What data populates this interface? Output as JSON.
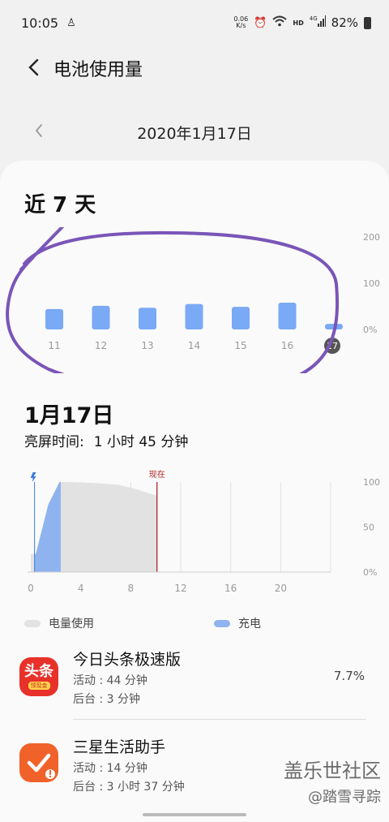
{
  "status_bar": {
    "time": "10:05",
    "net_speed_value": "0.06",
    "net_speed_unit": "K/s",
    "net_label": "HD",
    "net_type": "4G",
    "battery": "82%",
    "icons": [
      "notification-icon",
      "alarm-icon",
      "wifi-icon",
      "signal-icon",
      "battery-icon"
    ]
  },
  "header": {
    "title": "电池使用量",
    "back_icon": "back-arrow-icon"
  },
  "date_nav": {
    "date": "2020年1月17日",
    "prev_icon": "chevron-left-icon"
  },
  "week_section": {
    "title": "近 7 天"
  },
  "chart_data": [
    {
      "type": "bar",
      "categories": [
        "11",
        "12",
        "13",
        "14",
        "15",
        "16",
        "17"
      ],
      "values": [
        44,
        51,
        47,
        55,
        49,
        58,
        12
      ],
      "ylim": [
        0,
        200
      ],
      "y_ticks": [
        "0%",
        "100",
        "200"
      ],
      "selected_category": "17",
      "bar_color": "#7aa9f5"
    },
    {
      "type": "area",
      "x_ticks": [
        "0",
        "4",
        "8",
        "12",
        "16",
        "20"
      ],
      "y_ticks": [
        "0%",
        "50",
        "100"
      ],
      "ylim": [
        0,
        100
      ],
      "xlim": [
        0,
        24
      ],
      "now_label": "现在",
      "now_x": 10.1,
      "charging": {
        "start": 0.3,
        "end": 2.4
      },
      "level_points": [
        [
          0,
          20
        ],
        [
          0.4,
          20
        ],
        [
          1.4,
          75
        ],
        [
          2.3,
          100
        ],
        [
          3.0,
          100
        ],
        [
          5,
          99
        ],
        [
          7,
          97
        ],
        [
          8.5,
          92
        ],
        [
          9.3,
          88
        ],
        [
          10.1,
          85
        ]
      ],
      "colors": {
        "usage": "#e2e2e2",
        "charging": "#8fb3ee",
        "now": "#b02424",
        "bolt": "#3a7ce0"
      }
    }
  ],
  "day_section": {
    "title": "1月17日",
    "screen_time_label": "亮屏时间:",
    "screen_time_value": "1 小时 45 分钟"
  },
  "legend": {
    "usage_label": "电量使用",
    "charging_label": "充电",
    "usage_color": "#e2e2e2",
    "charging_color": "#8fb3ee"
  },
  "apps": [
    {
      "name": "今日头条极速版",
      "active": "活动 : 44 分钟",
      "background": "后台 : 3 分钟",
      "percent": "7.7%",
      "icon_text": "头条",
      "icon_sub": "领现金",
      "icon_color": "#e8312a"
    },
    {
      "name": "三星生活助手",
      "active": "活动 : 14 分钟",
      "background": "后台 : 3 小时 37 分钟",
      "percent": "",
      "icon_color": "#f0622a"
    }
  ],
  "watermark": {
    "line1": "盖乐世社区",
    "line2": "@踏雪寻踪"
  }
}
